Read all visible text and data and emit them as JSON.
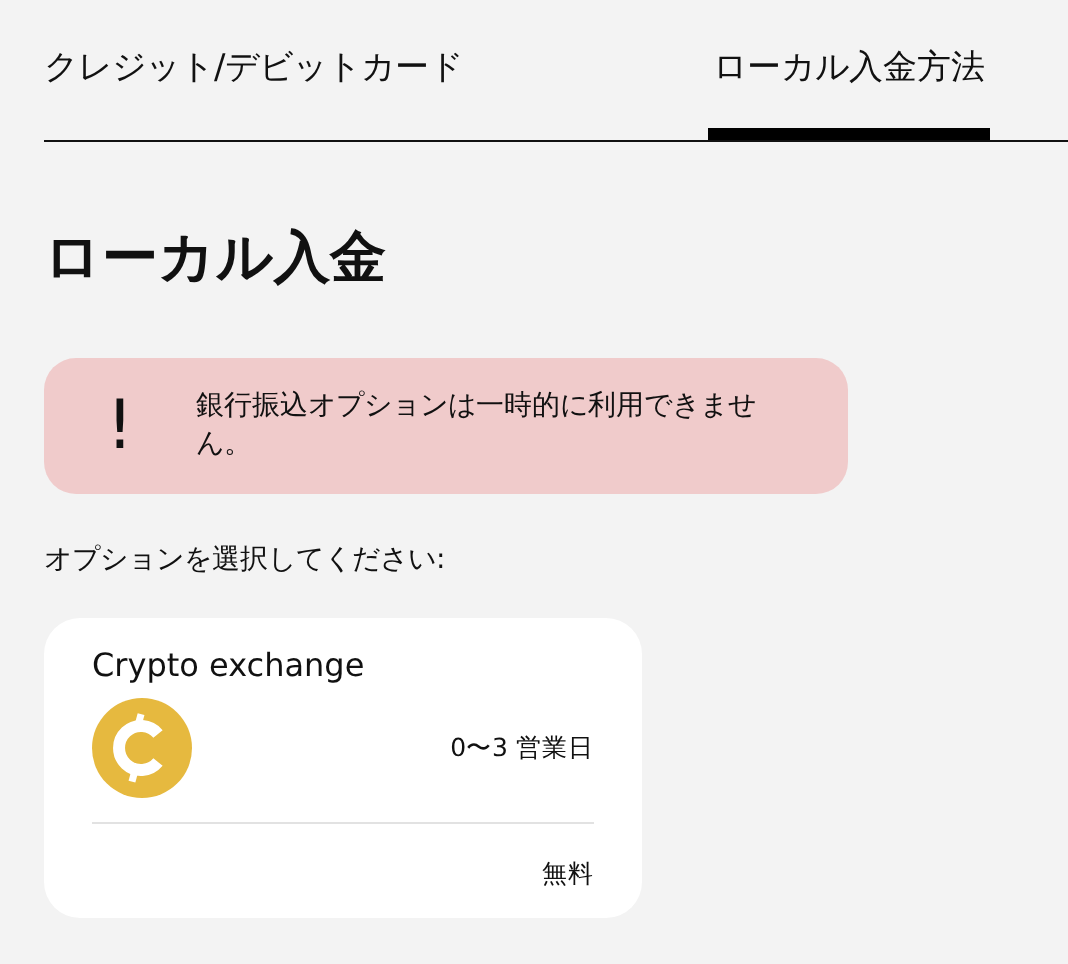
{
  "tabs": [
    {
      "label": "クレジット/デビットカード",
      "selected": false
    },
    {
      "label": "ローカル入金方法",
      "selected": true
    }
  ],
  "heading": "ローカル入金",
  "alert": {
    "icon": "!",
    "message": "銀行振込オプションは一時的に利用できません。"
  },
  "prompt": "オプションを選択してください:",
  "options": [
    {
      "name": "Crypto exchange",
      "time": "0〜3 営業日",
      "fee": "無料"
    }
  ]
}
